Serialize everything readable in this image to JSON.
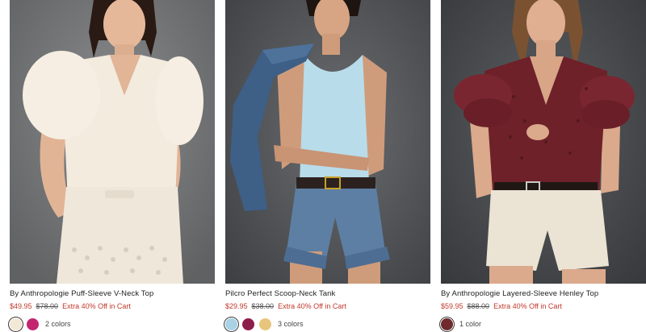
{
  "products": [
    {
      "title": "By Anthropologie Puff-Sleeve V-Neck Top",
      "sale_price": "$49.95",
      "original_price": "$78.00",
      "promo": "Extra 40% Off in Cart",
      "swatches": [
        "#f3e7d6",
        "#c2266f"
      ],
      "colors_label": "2 colors"
    },
    {
      "title": "Pilcro Perfect Scoop-Neck Tank",
      "sale_price": "$29.95",
      "original_price": "$38.00",
      "promo": "Extra 40% Off in Cart",
      "swatches": [
        "#a9d2e5",
        "#8e1c4b",
        "#e8c57c"
      ],
      "colors_label": "3 colors"
    },
    {
      "title": "By Anthropologie Layered-Sleeve Henley Top",
      "sale_price": "$59.95",
      "original_price": "$88.00",
      "promo": "Extra 40% Off in Cart",
      "swatches": [
        "#6e2a2c"
      ],
      "colors_label": "1 color"
    }
  ],
  "colors": {
    "sale_red": "#c0392b",
    "photo_background": "#6f7173"
  }
}
